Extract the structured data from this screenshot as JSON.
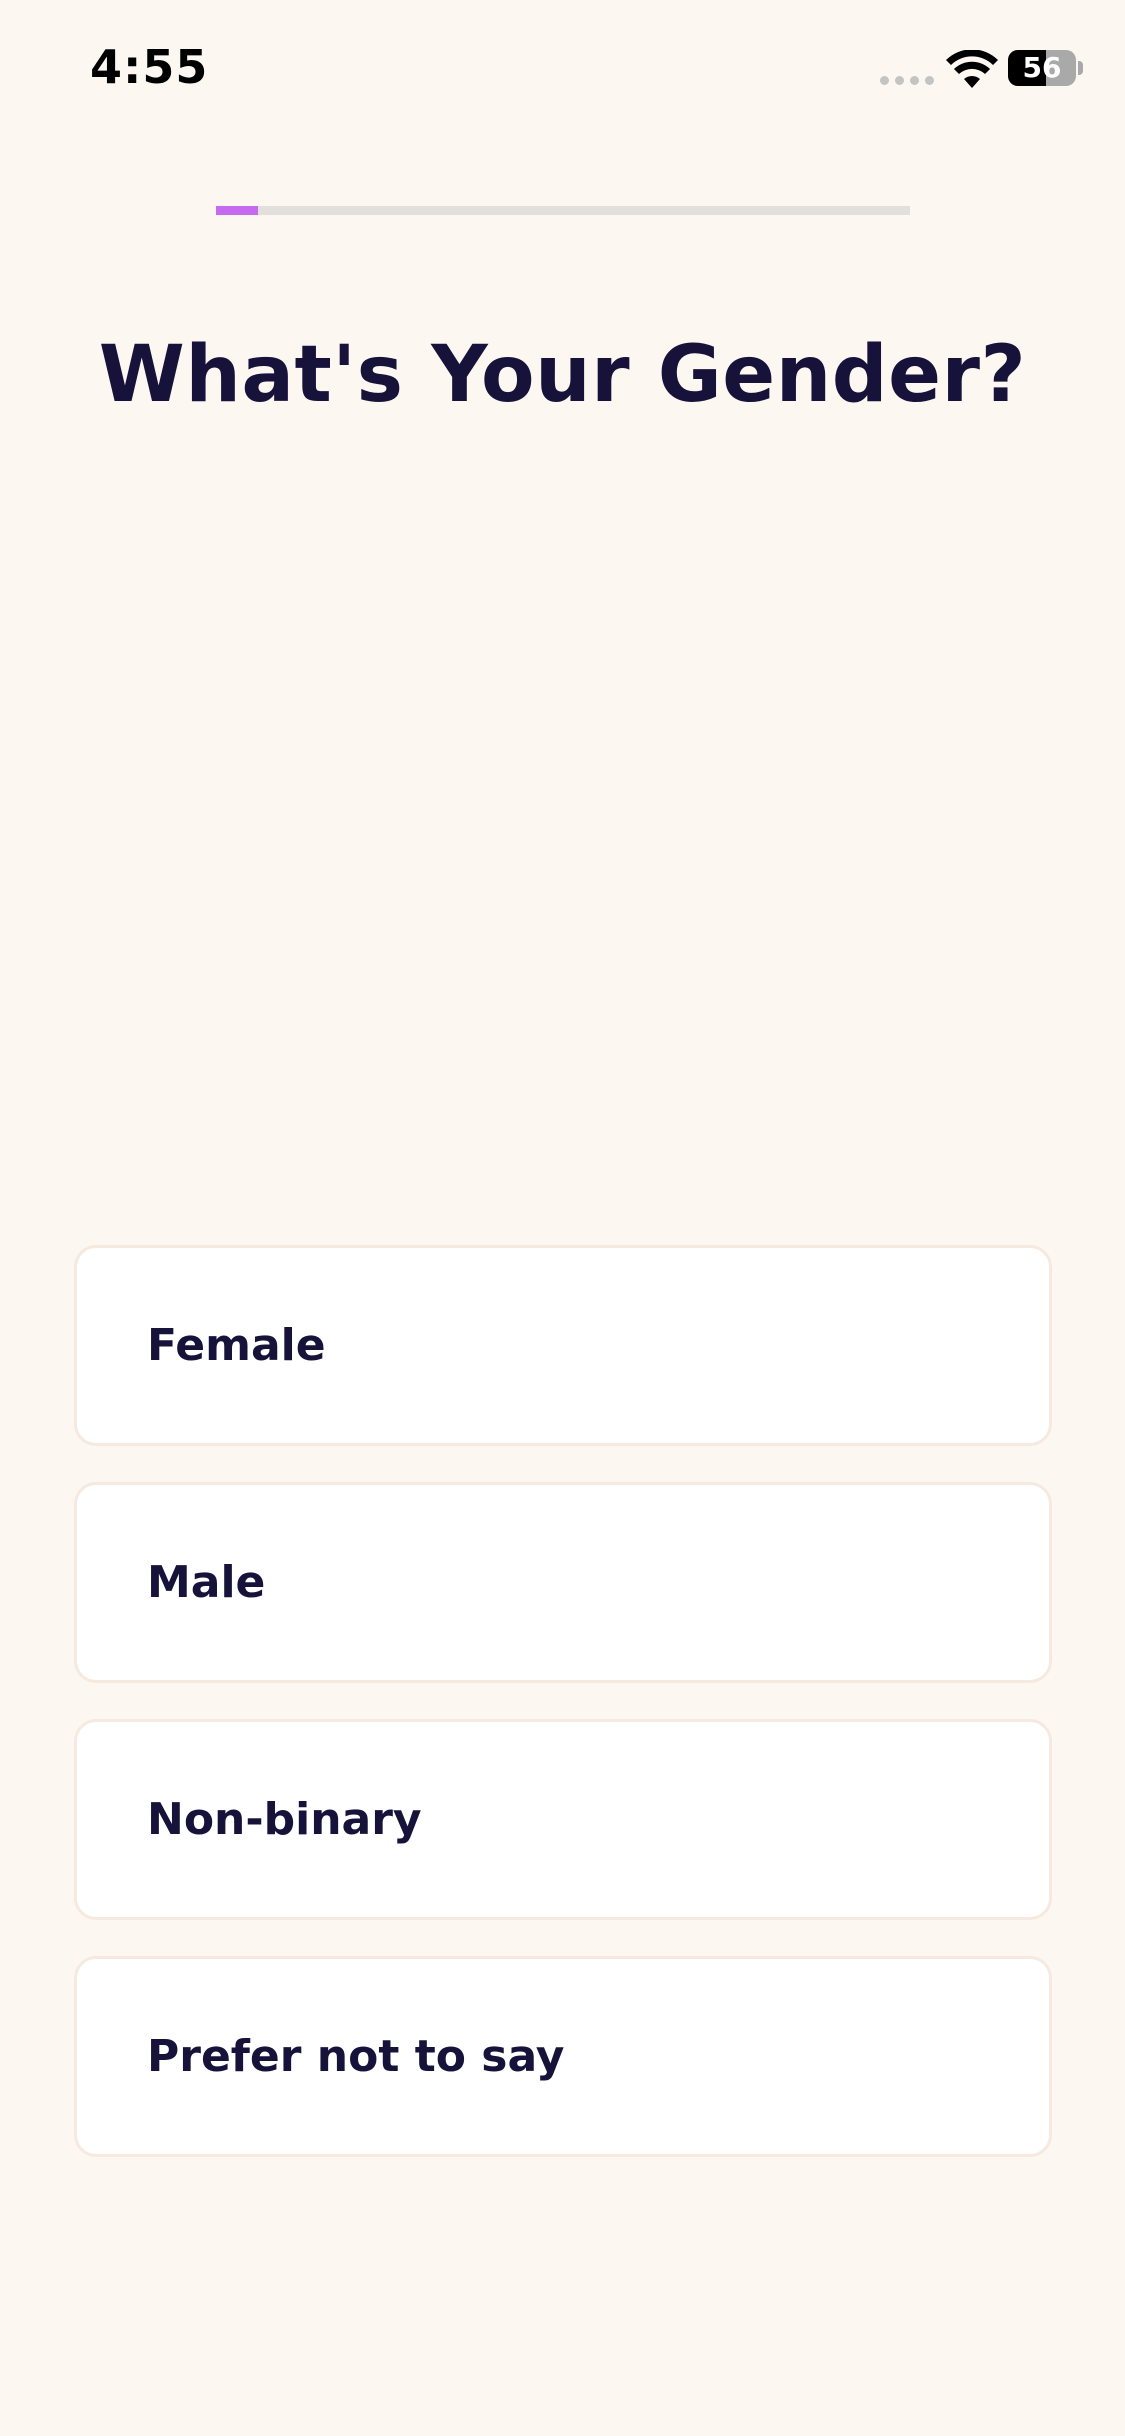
{
  "status_bar": {
    "time": "4:55",
    "battery_percent": "56",
    "battery_level": 0.56
  },
  "progress": {
    "value": 0.06,
    "track_color": "#e3dfdc",
    "fill_color": "#c76af0"
  },
  "title": "What's Your Gender?",
  "options": [
    {
      "label": "Female"
    },
    {
      "label": "Male"
    },
    {
      "label": "Non-binary"
    },
    {
      "label": "Prefer not to say"
    }
  ],
  "colors": {
    "background": "#fdf7f2",
    "text": "#17123a",
    "card": "#ffffff",
    "card_border": "#f6e9df"
  },
  "icons": [
    "signal-icon",
    "wifi-icon",
    "battery-icon"
  ]
}
